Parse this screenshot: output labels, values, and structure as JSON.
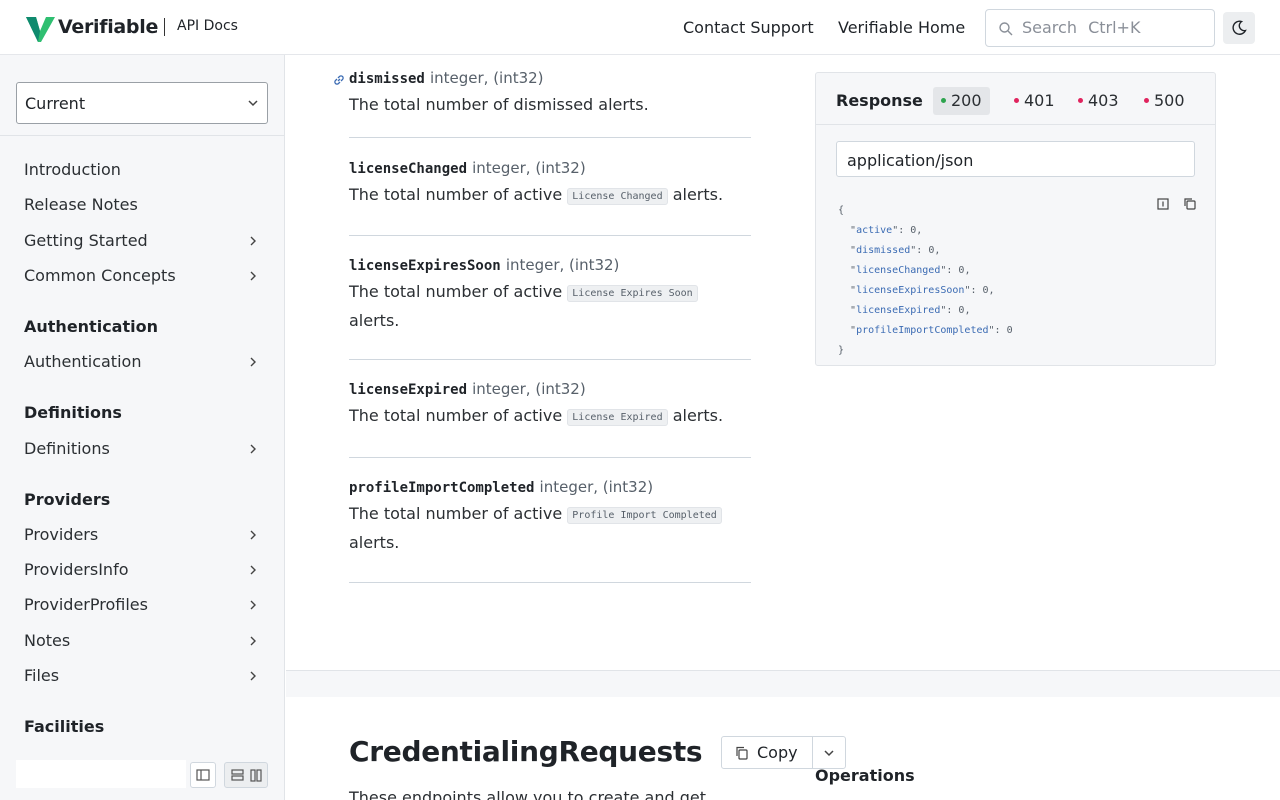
{
  "header": {
    "brand": "Verifiable",
    "sub": "API Docs",
    "links": [
      "Contact Support",
      "Verifiable Home"
    ],
    "search_placeholder": "Search",
    "search_shortcut": "Ctrl+K"
  },
  "sidebar": {
    "version": "Current",
    "items_top": [
      "Introduction",
      "Release Notes",
      "Getting Started",
      "Common Concepts"
    ],
    "sections": [
      {
        "title": "Authentication",
        "items": [
          "Authentication"
        ]
      },
      {
        "title": "Definitions",
        "items": [
          "Definitions"
        ]
      },
      {
        "title": "Providers",
        "items": [
          "Providers",
          "ProvidersInfo",
          "ProviderProfiles",
          "Notes",
          "Files"
        ]
      },
      {
        "title": "Facilities",
        "items": []
      }
    ]
  },
  "properties": [
    {
      "name": "dismissed",
      "type": "integer, (int32)",
      "desc_pre": "The total number of dismissed alerts.",
      "chip": "",
      "desc_post": ""
    },
    {
      "name": "licenseChanged",
      "type": "integer, (int32)",
      "desc_pre": "The total number of active",
      "chip": "License Changed",
      "desc_post": "alerts."
    },
    {
      "name": "licenseExpiresSoon",
      "type": "integer, (int32)",
      "desc_pre": "The total number of active",
      "chip": "License Expires Soon",
      "desc_post": "alerts."
    },
    {
      "name": "licenseExpired",
      "type": "integer, (int32)",
      "desc_pre": "The total number of active",
      "chip": "License Expired",
      "desc_post": "alerts."
    },
    {
      "name": "profileImportCompleted",
      "type": "integer, (int32)",
      "desc_pre": "The total number of active",
      "chip": "Profile Import Completed",
      "desc_post": "alerts."
    }
  ],
  "response": {
    "title": "Response",
    "codes": [
      {
        "code": "200",
        "color": "#2da44e"
      },
      {
        "code": "401",
        "color": "#e0245e"
      },
      {
        "code": "403",
        "color": "#e0245e"
      },
      {
        "code": "500",
        "color": "#e0245e"
      }
    ],
    "mime": "application/json",
    "json_open": "{",
    "json_close": "}",
    "json_fields": [
      {
        "key": "active",
        "value": "0"
      },
      {
        "key": "dismissed",
        "value": "0"
      },
      {
        "key": "licenseChanged",
        "value": "0"
      },
      {
        "key": "licenseExpiresSoon",
        "value": "0"
      },
      {
        "key": "licenseExpired",
        "value": "0"
      },
      {
        "key": "profileImportCompleted",
        "value": "0"
      }
    ]
  },
  "next_section": {
    "title": "CredentialingRequests",
    "copy_label": "Copy",
    "operations_label": "Operations",
    "desc": "These endpoints allow you to create and get"
  },
  "colors": {
    "brand_green": "#22c55e",
    "brand_teal": "#0f8a6e"
  }
}
